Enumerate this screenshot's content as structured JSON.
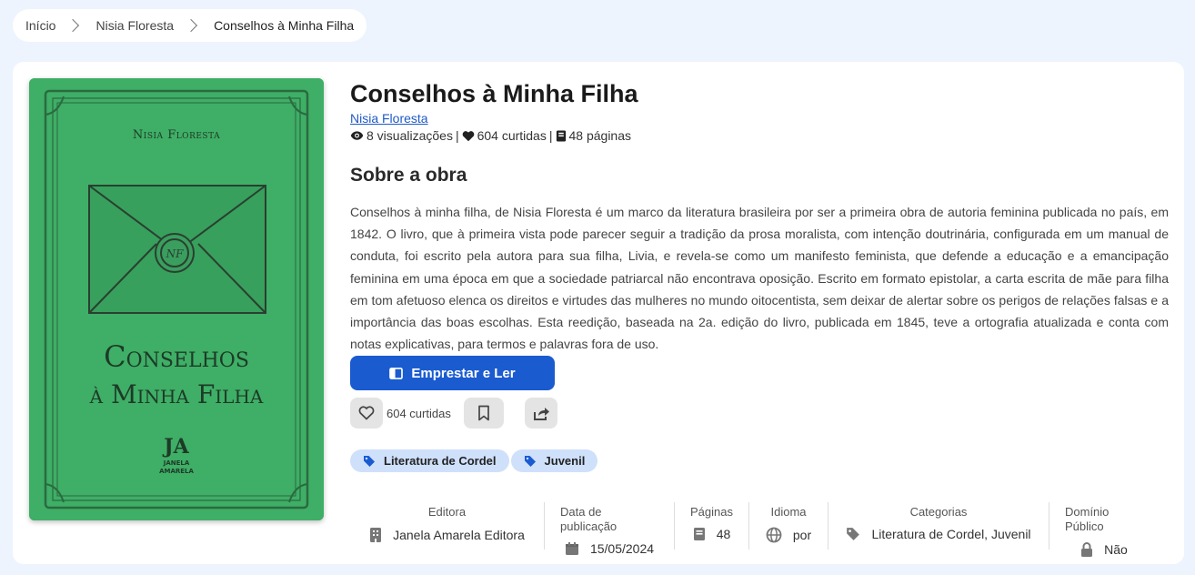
{
  "breadcrumb": {
    "home": "Início",
    "author": "Nisia Floresta",
    "current": "Conselhos à Minha Filha"
  },
  "cover": {
    "author": "Nisia Floresta",
    "title_line1": "Conselhos",
    "title_line2": "à Minha Filha",
    "seal": "NF",
    "publisher_line1": "JANELA",
    "publisher_line2": "AMARELA",
    "publisher_monogram": "JA",
    "background_color": "#3fae66"
  },
  "book": {
    "title": "Conselhos à Minha Filha",
    "author": "Nisia Floresta",
    "views": "8 visualizações",
    "likes": "604 curtidas",
    "pages": "48 páginas"
  },
  "about": {
    "heading": "Sobre a obra",
    "description": "Conselhos à minha filha, de Nisia Floresta é um marco da literatura brasileira por ser a primeira obra de autoria feminina publicada no país, em 1842. O livro, que à primeira vista pode parecer seguir a tradição da prosa moralista, com intenção doutrinária, configurada em um manual de conduta, foi escrito pela autora para sua filha, Livia, e revela-se como um manifesto feminista, que defende a educação e a emancipação feminina em uma época em que a sociedade patriarcal não encontrava oposição. Escrito em formato epistolar, a carta escrita de mãe para filha em tom afetuoso elenca os direitos e virtudes das mulheres no mundo oitocentista, sem deixar de alertar sobre os perigos de relações falsas e a importância das boas escolhas. Esta reedição, baseada na 2a. edição do livro, publicada em 1845, teve a ortografia atualizada e conta com notas explicativas, para termos e palavras fora de uso."
  },
  "actions": {
    "read_button": "Emprestar e Ler",
    "like_count": "604 curtidas"
  },
  "tags": [
    "Literatura de Cordel",
    "Juvenil"
  ],
  "meta": {
    "publisher_label": "Editora",
    "publisher": "Janela Amarela Editora",
    "date_label": "Data de publicação",
    "date": "15/05/2024",
    "pages_label": "Páginas",
    "pages": "48",
    "language_label": "Idioma",
    "language": "por",
    "categories_label": "Categorias",
    "categories": "Literatura de Cordel, Juvenil",
    "public_domain_label": "Domínio Público",
    "public_domain": "Não"
  },
  "colors": {
    "accent": "#1a5bd0",
    "tag_bg": "#cfe0fb",
    "page_bg": "#eef4fd"
  }
}
